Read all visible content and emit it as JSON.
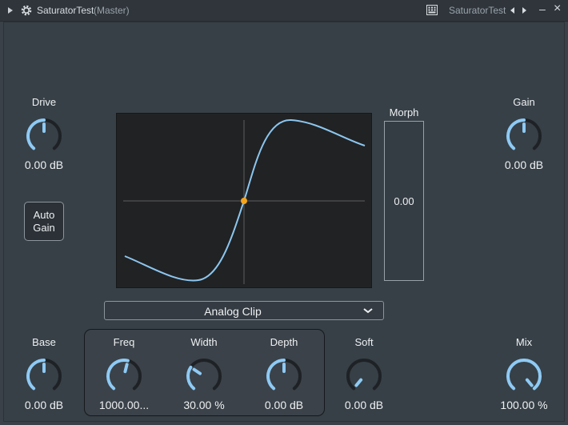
{
  "window": {
    "title": "SaturatorTest",
    "subtitle": "(Master)",
    "preset_name": "SaturatorTest",
    "minimize_glyph": "–",
    "close_glyph": "×"
  },
  "controls": {
    "drive": {
      "label": "Drive",
      "value": "0.00 dB",
      "level": 0.5
    },
    "gain": {
      "label": "Gain",
      "value": "0.00 dB",
      "level": 0.5
    },
    "base": {
      "label": "Base",
      "value": "0.00 dB",
      "level": 0.5
    },
    "freq": {
      "label": "Freq",
      "value": "1000.00...",
      "level": 0.55
    },
    "width": {
      "label": "Width",
      "value": "30.00 %",
      "level": 0.3
    },
    "depth": {
      "label": "Depth",
      "value": "0.00 dB",
      "level": 0.5
    },
    "soft": {
      "label": "Soft",
      "value": "0.00 dB",
      "level": 0.0
    },
    "mix": {
      "label": "Mix",
      "value": "100.00 %",
      "level": 1.0
    }
  },
  "auto_gain": {
    "line1": "Auto",
    "line2": "Gain"
  },
  "morph": {
    "label": "Morph",
    "value": "0.00"
  },
  "mode_select": {
    "selected": "Analog Clip"
  },
  "colors": {
    "accent": "#8ecaf4",
    "track": "#1e2226",
    "curve": "#8cc6ef",
    "center_point": "#f4a51c"
  },
  "icons": {
    "expand": "triangle-right-icon",
    "settings": "gear-icon",
    "keyboard": "keyboard-icon",
    "prev": "triangle-left-icon",
    "next": "triangle-right-icon",
    "minimize": "minimize-icon",
    "close": "close-icon",
    "dropdown": "chevron-down-icon"
  }
}
